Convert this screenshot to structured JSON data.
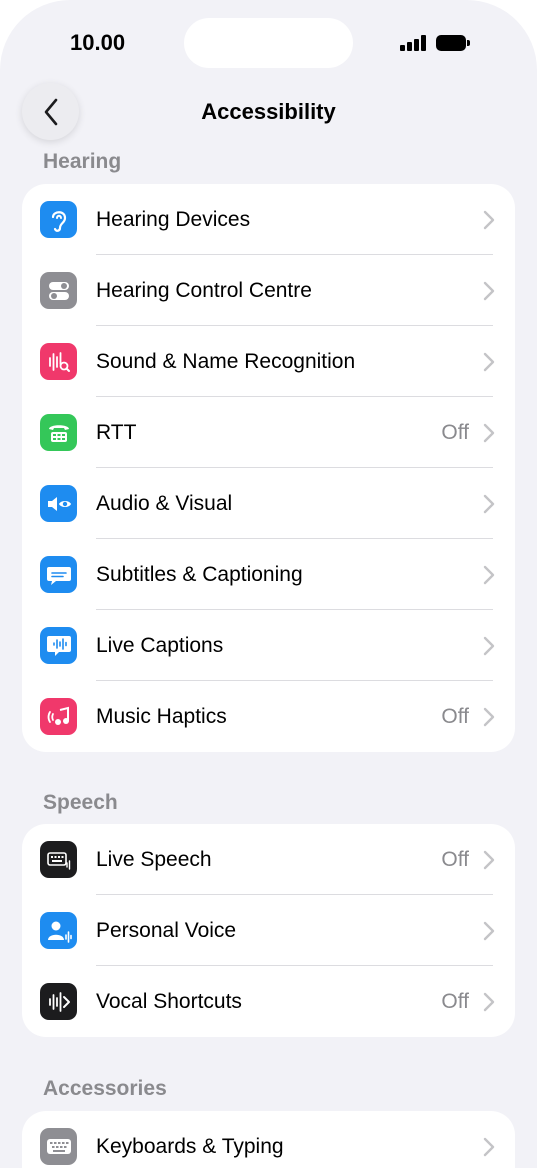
{
  "status": {
    "time": "10.00"
  },
  "nav": {
    "title": "Accessibility",
    "back_label": "Back"
  },
  "sections": [
    {
      "header": "Hearing",
      "items": [
        {
          "label": "Hearing Devices",
          "value": ""
        },
        {
          "label": "Hearing Control Centre",
          "value": ""
        },
        {
          "label": "Sound & Name Recognition",
          "value": ""
        },
        {
          "label": "RTT",
          "value": "Off"
        },
        {
          "label": "Audio & Visual",
          "value": ""
        },
        {
          "label": "Subtitles & Captioning",
          "value": ""
        },
        {
          "label": "Live Captions",
          "value": ""
        },
        {
          "label": "Music Haptics",
          "value": "Off"
        }
      ]
    },
    {
      "header": "Speech",
      "items": [
        {
          "label": "Live Speech",
          "value": "Off"
        },
        {
          "label": "Personal Voice",
          "value": ""
        },
        {
          "label": "Vocal Shortcuts",
          "value": "Off"
        }
      ]
    },
    {
      "header": "Accessories",
      "items": [
        {
          "label": "Keyboards & Typing",
          "value": ""
        }
      ]
    }
  ],
  "colors": {
    "background": "#f2f2f7",
    "secondary_text": "#8a8a8e",
    "blue_icon": "#1e8cf0",
    "grey_icon": "#8e8e93",
    "pink_icon": "#f0386b",
    "green_icon": "#34c759",
    "black_icon": "#1c1c1e"
  }
}
